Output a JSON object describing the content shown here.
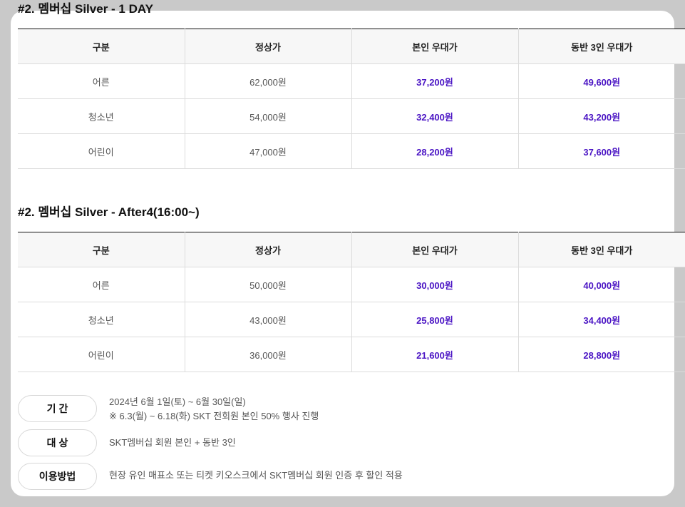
{
  "sections": [
    {
      "title": "#2. 멤버십 Silver - 1 DAY",
      "headers": [
        "구분",
        "정상가",
        "본인 우대가",
        "동반 3인 우대가"
      ],
      "rows": [
        [
          "어른",
          "62,000원",
          "37,200원",
          "49,600원"
        ],
        [
          "청소년",
          "54,000원",
          "32,400원",
          "43,200원"
        ],
        [
          "어린이",
          "47,000원",
          "28,200원",
          "37,600원"
        ]
      ]
    },
    {
      "title": "#2. 멤버십 Silver - After4(16:00~)",
      "headers": [
        "구분",
        "정상가",
        "본인 우대가",
        "동반 3인 우대가"
      ],
      "rows": [
        [
          "어른",
          "50,000원",
          "30,000원",
          "40,000원"
        ],
        [
          "청소년",
          "43,000원",
          "25,800원",
          "34,400원"
        ],
        [
          "어린이",
          "36,000원",
          "21,600원",
          "28,800원"
        ]
      ]
    }
  ],
  "info": [
    {
      "label": "기 간",
      "lines": [
        "2024년 6월 1일(토) ~ 6월 30일(일)",
        "※ 6.3(월) ~ 6.18(화) SKT 전회원 본인 50% 행사 진행"
      ]
    },
    {
      "label": "대 상",
      "lines": [
        "SKT멤버십 회원 본인 + 동반 3인"
      ]
    },
    {
      "label": "이용방법",
      "lines": [
        "현장 유인 매표소 또는 티켓 키오스크에서 SKT멤버십 회원 인증 후 할인 적용"
      ]
    }
  ],
  "colors": {
    "background": "#c9c9c9",
    "card": "#ffffff",
    "accent_price": "#4a14c4",
    "header_bg": "#f7f7f7"
  }
}
